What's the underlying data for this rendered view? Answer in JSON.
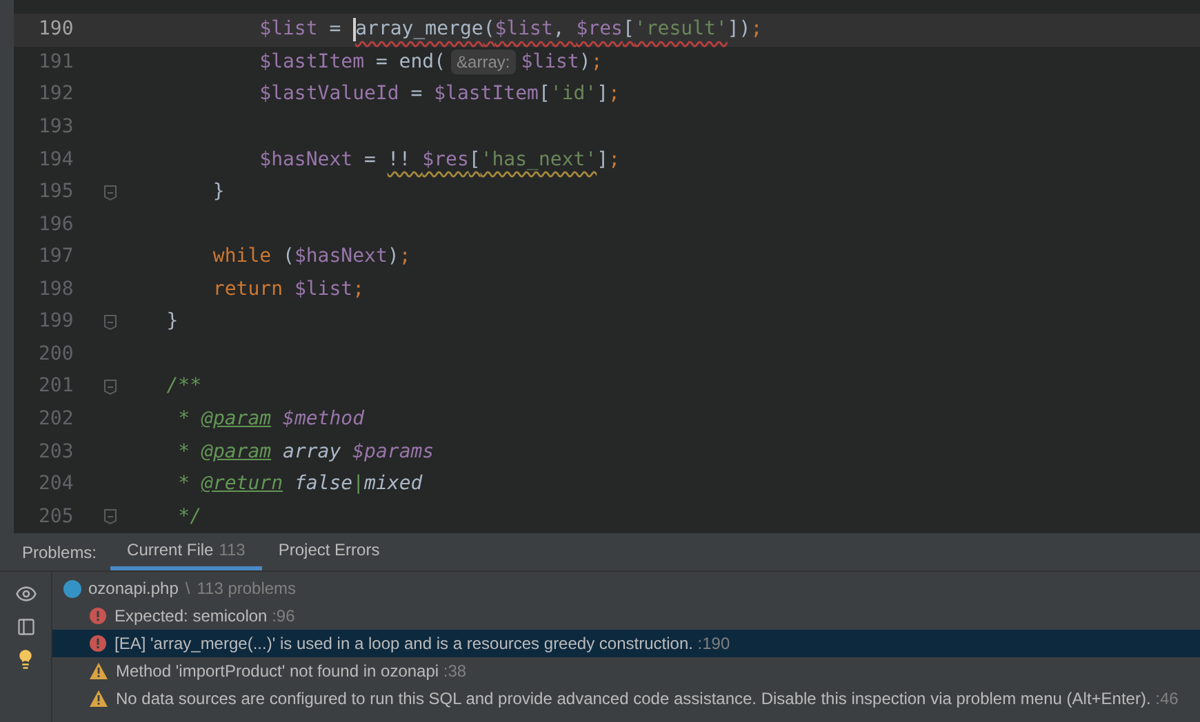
{
  "editor": {
    "lines": [
      {
        "number": "190",
        "current": true,
        "kind": "plain",
        "tokens": [
          {
            "kind": "var",
            "text": "            $list"
          },
          {
            "kind": "plain",
            "text": " = "
          },
          {
            "kind": "fn",
            "text": "array_merge",
            "caret": true,
            "error_squiggle": true
          },
          {
            "kind": "plain",
            "text": "(",
            "error_squiggle": true
          },
          {
            "kind": "var",
            "text": "$list",
            "error_squiggle": true
          },
          {
            "kind": "plain",
            "text": ", ",
            "error_squiggle": true
          },
          {
            "kind": "var",
            "text": "$res",
            "error_squiggle": true
          },
          {
            "kind": "plain",
            "text": "[",
            "error_squiggle": true
          },
          {
            "kind": "str",
            "text": "'result'",
            "error_squiggle": true
          },
          {
            "kind": "plain",
            "text": "])"
          },
          {
            "kind": "kw",
            "text": ";"
          }
        ]
      },
      {
        "number": "191",
        "current": false,
        "kind": "plain",
        "tokens": [
          {
            "kind": "var",
            "text": "            $lastItem"
          },
          {
            "kind": "plain",
            "text": " = end("
          },
          {
            "kind": "hint",
            "text": "&array:"
          },
          {
            "kind": "var",
            "text": "$list"
          },
          {
            "kind": "plain",
            "text": ")"
          },
          {
            "kind": "kw",
            "text": ";"
          }
        ]
      },
      {
        "number": "192",
        "current": false,
        "kind": "plain",
        "tokens": [
          {
            "kind": "var",
            "text": "            $lastValueId"
          },
          {
            "kind": "plain",
            "text": " = "
          },
          {
            "kind": "var",
            "text": "$lastItem"
          },
          {
            "kind": "plain",
            "text": "["
          },
          {
            "kind": "str",
            "text": "'id'"
          },
          {
            "kind": "plain",
            "text": "]"
          },
          {
            "kind": "kw",
            "text": ";"
          }
        ]
      },
      {
        "number": "193",
        "current": false,
        "kind": "plain"
      },
      {
        "number": "194",
        "current": false,
        "kind": "plain",
        "tokens": [
          {
            "kind": "var",
            "text": "            $hasNext"
          },
          {
            "kind": "plain",
            "text": " = "
          },
          {
            "kind": "plain",
            "text": "!! ",
            "warning_squiggle": true
          },
          {
            "kind": "var",
            "text": "$res",
            "warning_squiggle": true
          },
          {
            "kind": "plain",
            "text": "[",
            "warning_squiggle": true
          },
          {
            "kind": "str",
            "text": "'has_next'",
            "warning_squiggle": true
          },
          {
            "kind": "plain",
            "text": "]"
          },
          {
            "kind": "kw",
            "text": ";"
          }
        ]
      },
      {
        "number": "195",
        "current": false,
        "kind": "fold",
        "tokens": [
          {
            "kind": "plain",
            "text": "        }"
          }
        ]
      },
      {
        "number": "196",
        "current": false,
        "kind": "plain"
      },
      {
        "number": "197",
        "current": false,
        "kind": "plain",
        "tokens": [
          {
            "kind": "kw",
            "text": "        while"
          },
          {
            "kind": "plain",
            "text": " ("
          },
          {
            "kind": "var",
            "text": "$hasNext"
          },
          {
            "kind": "plain",
            "text": ")"
          },
          {
            "kind": "kw",
            "text": ";"
          }
        ]
      },
      {
        "number": "198",
        "current": false,
        "kind": "plain",
        "tokens": [
          {
            "kind": "kw",
            "text": "        return "
          },
          {
            "kind": "var",
            "text": "$list"
          },
          {
            "kind": "kw",
            "text": ";"
          }
        ]
      },
      {
        "number": "199",
        "current": false,
        "kind": "fold",
        "tokens": [
          {
            "kind": "plain",
            "text": "    }"
          }
        ]
      },
      {
        "number": "200",
        "current": false,
        "kind": "plain"
      },
      {
        "number": "201",
        "current": false,
        "kind": "fold",
        "tokens": [
          {
            "kind": "doc",
            "text": "    /**"
          }
        ]
      },
      {
        "number": "202",
        "current": false,
        "kind": "plain",
        "tokens": [
          {
            "kind": "doc",
            "text": "     * "
          },
          {
            "kind": "doctag",
            "text": "@param"
          },
          {
            "kind": "docvar",
            "text": " $method"
          }
        ]
      },
      {
        "number": "203",
        "current": false,
        "kind": "plain",
        "tokens": [
          {
            "kind": "doc",
            "text": "     * "
          },
          {
            "kind": "doctag",
            "text": "@param"
          },
          {
            "kind": "doctype",
            "text": " array"
          },
          {
            "kind": "docvar",
            "text": " $params"
          }
        ]
      },
      {
        "number": "204",
        "current": false,
        "kind": "plain",
        "tokens": [
          {
            "kind": "doc",
            "text": "     * "
          },
          {
            "kind": "doctag",
            "text": "@return"
          },
          {
            "kind": "doctype",
            "text": " false"
          },
          {
            "kind": "doc",
            "text": "|"
          },
          {
            "kind": "doctype",
            "text": "mixed"
          }
        ]
      },
      {
        "number": "205",
        "current": false,
        "kind": "fold",
        "tokens": [
          {
            "kind": "doc",
            "text": "     */"
          }
        ]
      }
    ]
  },
  "problems": {
    "label": "Problems:",
    "tabs": [
      {
        "label": "Current File",
        "count": "113",
        "selected": true
      },
      {
        "label": "Project Errors",
        "selected": false
      }
    ],
    "file": {
      "name": "ozonapi.php",
      "separator": "\\",
      "count": "113 problems"
    },
    "items": [
      {
        "kind": "error",
        "message": "Expected: semicolon",
        "location": ":96",
        "selected": false
      },
      {
        "kind": "error",
        "message": "[EA] 'array_merge(...)' is used in a loop and is a resources greedy construction.",
        "location": ":190",
        "selected": true
      },
      {
        "kind": "warning",
        "message": "Method 'importProduct' not found in ozonapi",
        "location": ":38",
        "selected": false
      },
      {
        "kind": "warning",
        "message": "No data sources are configured to run this SQL and provide advanced code assistance. Disable this inspection via problem menu (Alt+Enter).",
        "location": ":46",
        "selected": false
      }
    ]
  }
}
